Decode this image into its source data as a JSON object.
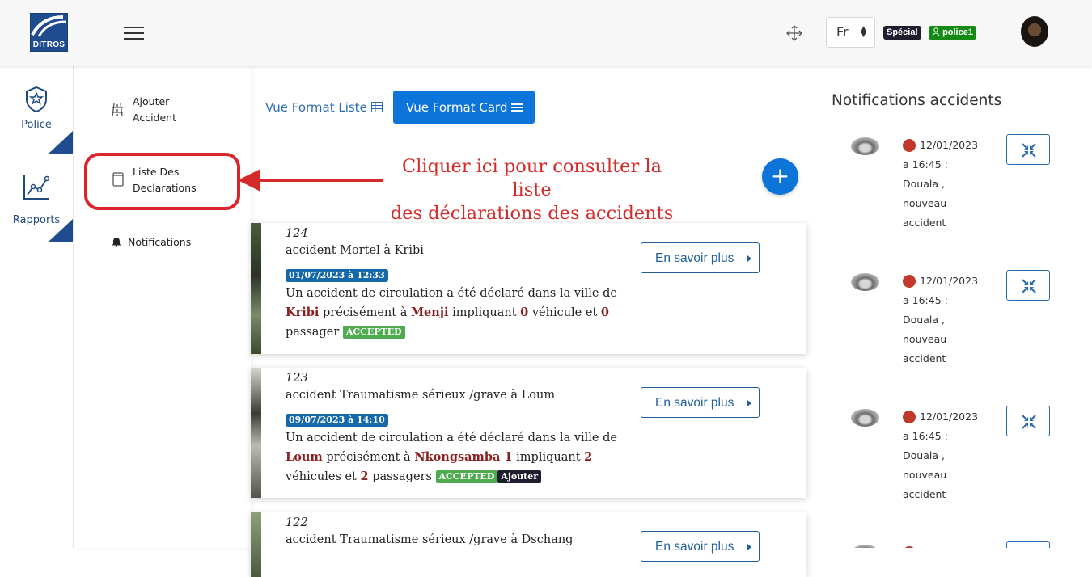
{
  "header": {
    "logo_text": "DITROS",
    "language": "Fr",
    "role_badge": "Spécial",
    "user_badge": "police1"
  },
  "leftnav": {
    "items": [
      {
        "label": "Police",
        "icon": "shield-star-icon"
      },
      {
        "label": "Rapports",
        "icon": "line-chart-icon"
      }
    ]
  },
  "submenu": {
    "items": [
      {
        "line1": "Ajouter",
        "line2": "Accident",
        "icon": "road-icon"
      },
      {
        "line1": "Liste Des",
        "line2": "Declarations",
        "icon": "document-icon"
      },
      {
        "line1": "Notifications",
        "line2": "",
        "icon": "bell-icon"
      }
    ]
  },
  "annotation": {
    "line1": "Cliquer ici pour consulter la liste",
    "line2": "des déclarations des accidents",
    "color": "#d42a2a"
  },
  "toolbar": {
    "list_view_label": "Vue Format Liste",
    "card_view_label": "Vue Format Card",
    "add_label": "+"
  },
  "cards": [
    {
      "number": "124",
      "title": "accident Mortel à Kribi",
      "date": "01/07/2023 à 12:33",
      "text_a": "Un accident de circulation a été déclaré dans la ville de ",
      "city": "Kribi",
      "text_b": " précisément à ",
      "place": "Menji",
      "text_c": " impliquant ",
      "vehicles": "0",
      "text_d": " véhicule et ",
      "passengers": "0",
      "text_e": " passager",
      "status": "ACCEPTED",
      "extra_badge": "",
      "more_label": "En savoir plus"
    },
    {
      "number": "123",
      "title": "accident Traumatisme sérieux /grave à Loum",
      "date": "09/07/2023 à 14:10",
      "text_a": "Un accident de circulation a été déclaré dans la ville de ",
      "city": "Loum",
      "text_b": " précisément à ",
      "place": "Nkongsamba 1",
      "text_c": " impliquant ",
      "vehicles": "2",
      "text_d": " véhicules et ",
      "passengers": "2",
      "text_e": " passagers",
      "status": "ACCEPTED",
      "extra_badge": "Ajouter",
      "more_label": "En savoir plus"
    },
    {
      "number": "122",
      "title": "accident Traumatisme sérieux /grave à Dschang",
      "more_label": "En savoir plus"
    }
  ],
  "notifications": {
    "title": "Notifications accidents",
    "items": [
      {
        "date": "12/01/2023",
        "time": "a 16:45 :",
        "city": "Douala ,",
        "line3": "nouveau",
        "line4": "accident"
      },
      {
        "date": "12/01/2023",
        "time": "a 16:45 :",
        "city": "Douala ,",
        "line3": "nouveau",
        "line4": "accident"
      },
      {
        "date": "12/01/2023",
        "time": "a 16:45 :",
        "city": "Douala ,",
        "line3": "nouveau",
        "line4": "accident"
      }
    ]
  }
}
